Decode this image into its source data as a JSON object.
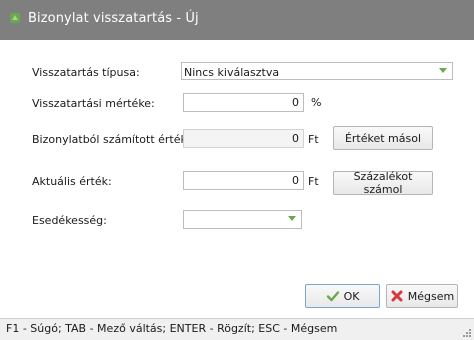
{
  "window": {
    "title": "Bizonylat visszatartás - Új"
  },
  "form": {
    "type_label": "Visszatartás típusa:",
    "type_value": "Nincs kiválasztva",
    "amount_label": "Visszatartási mértéke:",
    "amount_value": "0",
    "amount_unit": "%",
    "calculated_label": "Bizonylatból számított érték:",
    "calculated_value": "0",
    "calculated_unit": "Ft",
    "copy_value_button": "Értéket másol",
    "current_label": "Aktuális érték:",
    "current_value": "0",
    "current_unit": "Ft",
    "calc_percent_button": "Százalékot számol",
    "due_label": "Esedékesség:",
    "due_value": ""
  },
  "actions": {
    "ok_label": "OK",
    "cancel_label": "Mégsem"
  },
  "statusbar": {
    "text": "F1 - Súgó; TAB - Mező váltás; ENTER - Rögzít; ESC - Mégsem"
  },
  "colors": {
    "titlebar": "#7f7f7f",
    "accent_green": "#6aa84f",
    "cancel_red": "#d9363e",
    "dropdown_arrow": "#6aa84f"
  },
  "icons": {
    "title": "app-leaf-icon",
    "ok": "checkmark-icon",
    "cancel": "x-icon",
    "dropdown": "chevron-down-icon"
  }
}
